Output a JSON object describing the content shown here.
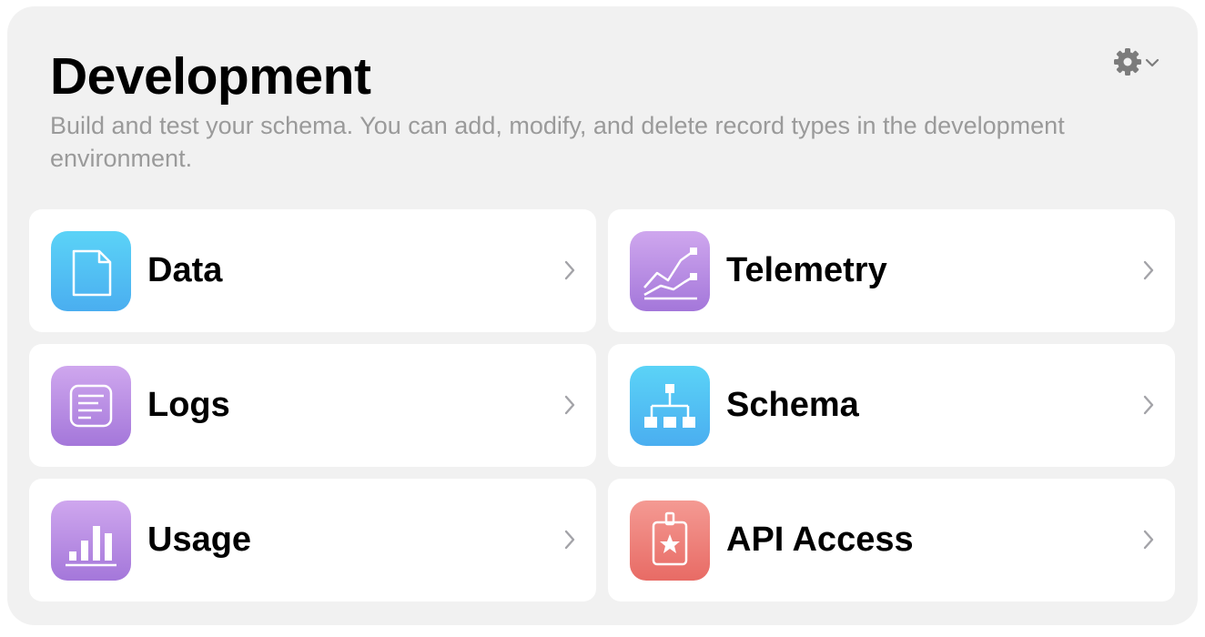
{
  "header": {
    "title": "Development",
    "subtitle": "Build and test your schema. You can add, modify, and delete record types in the development environment."
  },
  "settings": {
    "icon": "gear-icon",
    "menu_icon": "chevron-down-icon"
  },
  "cards": [
    {
      "label": "Data",
      "icon": "document-icon",
      "color": "#4fbdf3"
    },
    {
      "label": "Telemetry",
      "icon": "line-chart-icon",
      "color": "#b98ce4"
    },
    {
      "label": "Logs",
      "icon": "log-text-icon",
      "color": "#b98ce4"
    },
    {
      "label": "Schema",
      "icon": "hierarchy-icon",
      "color": "#4fbdf3"
    },
    {
      "label": "Usage",
      "icon": "bar-chart-icon",
      "color": "#b98ce4"
    },
    {
      "label": "API Access",
      "icon": "badge-star-icon",
      "color": "#ec7d76"
    }
  ]
}
